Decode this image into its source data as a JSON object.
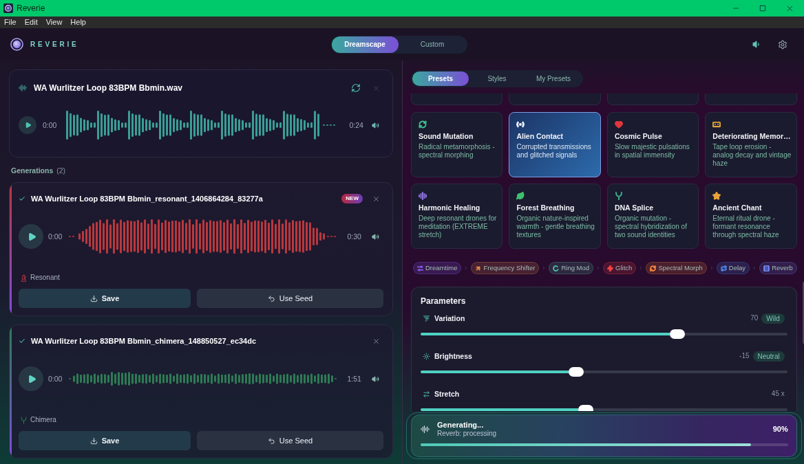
{
  "window": {
    "title": "Reverie"
  },
  "menu": [
    "File",
    "Edit",
    "View",
    "Help"
  ],
  "header": {
    "logo": "REVERIE",
    "modes": [
      {
        "label": "Dreamscape",
        "selected": true
      },
      {
        "label": "Custom",
        "selected": false
      }
    ]
  },
  "source": {
    "title": "WA Wurlitzer Loop 83BPM Bbmin.wav",
    "time": "0:00",
    "duration": "0:24"
  },
  "generations": {
    "title": "Generations",
    "count": "(2)",
    "items": [
      {
        "title": "WA Wurlitzer Loop 83BPM Bbmin_resonant_1406864284_83277a",
        "badge": "NEW",
        "color": "#b8383e",
        "time": "0:00",
        "duration": "0:30",
        "style": "Resonant",
        "save": "Save",
        "use_seed": "Use Seed"
      },
      {
        "title": "WA Wurlitzer Loop 83BPM Bbmin_chimera_148850527_ec34dc",
        "color": "#2e7a55",
        "time": "0:00",
        "duration": "1:51",
        "style": "Chimera",
        "save": "Save",
        "use_seed": "Use Seed"
      }
    ]
  },
  "panel_tabs": [
    {
      "label": "Presets",
      "selected": true
    },
    {
      "label": "Styles",
      "selected": false
    },
    {
      "label": "My Presets",
      "selected": false
    }
  ],
  "presets": [
    {
      "title": "Sound Mutation",
      "description": "Radical metamorphosis - spectral morphing",
      "color": "#3fbf8f",
      "selected": false
    },
    {
      "title": "Alien Contact",
      "description": "Corrupted transmissions and glitched signals",
      "color": "#e8eef8",
      "selected": true
    },
    {
      "title": "Cosmic Pulse",
      "description": "Slow majestic pulsations in spatial immensity",
      "color": "#e0363c",
      "selected": false
    },
    {
      "title": "Deteriorating Memor…",
      "description": "Tape loop erosion - analog decay and vintage haze",
      "color": "#e0a33a",
      "selected": false
    },
    {
      "title": "Harmonic Healing",
      "description": "Deep resonant drones for meditation (EXTREME stretch)",
      "color": "#8b6fd9",
      "selected": false
    },
    {
      "title": "Forest Breathing",
      "description": "Organic nature-inspired warmth - gentle breathing textures",
      "color": "#3fbf6f",
      "selected": false
    },
    {
      "title": "DNA Splice",
      "description": "Organic mutation - spectral hybridization of two sound identities",
      "color": "#3fa98a",
      "selected": false
    },
    {
      "title": "Ancient Chant",
      "description": "Eternal ritual drone - formant resonance through spectral haze",
      "color": "#e8a23a",
      "selected": false
    }
  ],
  "effect_chain": [
    {
      "label": "Dreamtime",
      "color": "#8b5cf6"
    },
    {
      "label": "Frequency Shifter",
      "color": "#e08a4a"
    },
    {
      "label": "Ring Mod",
      "color": "#4fb3a0"
    },
    {
      "label": "Glitch",
      "color": "#ef4444"
    },
    {
      "label": "Spectral Morph",
      "color": "#f0803a"
    },
    {
      "label": "Delay",
      "color": "#4a7fe0"
    },
    {
      "label": "Reverb",
      "color": "#6a7ae0"
    }
  ],
  "parameters": {
    "title": "Parameters",
    "items": [
      {
        "label": "Variation",
        "value": "70",
        "badge": "Wild",
        "level": 0.7
      },
      {
        "label": "Brightness",
        "value": "-15",
        "badge": "Neutral",
        "level": 0.425
      },
      {
        "label": "Stretch",
        "value": "45 x",
        "level": 0.45
      }
    ]
  },
  "progress": {
    "title": "Generating...",
    "detail": "Reverb: processing",
    "percent": "90%",
    "level": 0.9
  }
}
